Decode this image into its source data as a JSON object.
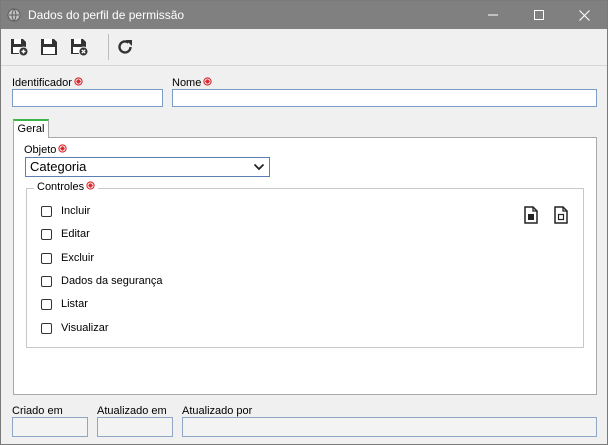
{
  "window": {
    "title": "Dados do perfil de permissão"
  },
  "toolbar": {
    "buttons": [
      "save-and-new-icon",
      "save-icon",
      "save-and-close-icon",
      "refresh-icon"
    ]
  },
  "form": {
    "identificador_label": "Identificador",
    "identificador_value": "",
    "nome_label": "Nome",
    "nome_value": ""
  },
  "tabs": [
    {
      "label": "Geral",
      "active": true
    }
  ],
  "objeto": {
    "label": "Objeto",
    "selected": "Categoria"
  },
  "controles": {
    "legend": "Controles",
    "items": [
      {
        "label": "Incluir",
        "checked": false
      },
      {
        "label": "Editar",
        "checked": false
      },
      {
        "label": "Excluir",
        "checked": false
      },
      {
        "label": "Dados da segurança",
        "checked": false
      },
      {
        "label": "Listar",
        "checked": false
      },
      {
        "label": "Visualizar",
        "checked": false
      }
    ],
    "actions": [
      "check-all-icon",
      "uncheck-all-icon"
    ]
  },
  "footer": {
    "criado_label": "Criado em",
    "criado_value": "",
    "atualizado_label": "Atualizado em",
    "atualizado_value": "",
    "atualizado_por_label": "Atualizado por",
    "atualizado_por_value": ""
  },
  "colors": {
    "titlebar": "#808080",
    "required": "#d9262c",
    "tab_accent": "#3cb44a",
    "field_border": "#7a9cc6"
  }
}
